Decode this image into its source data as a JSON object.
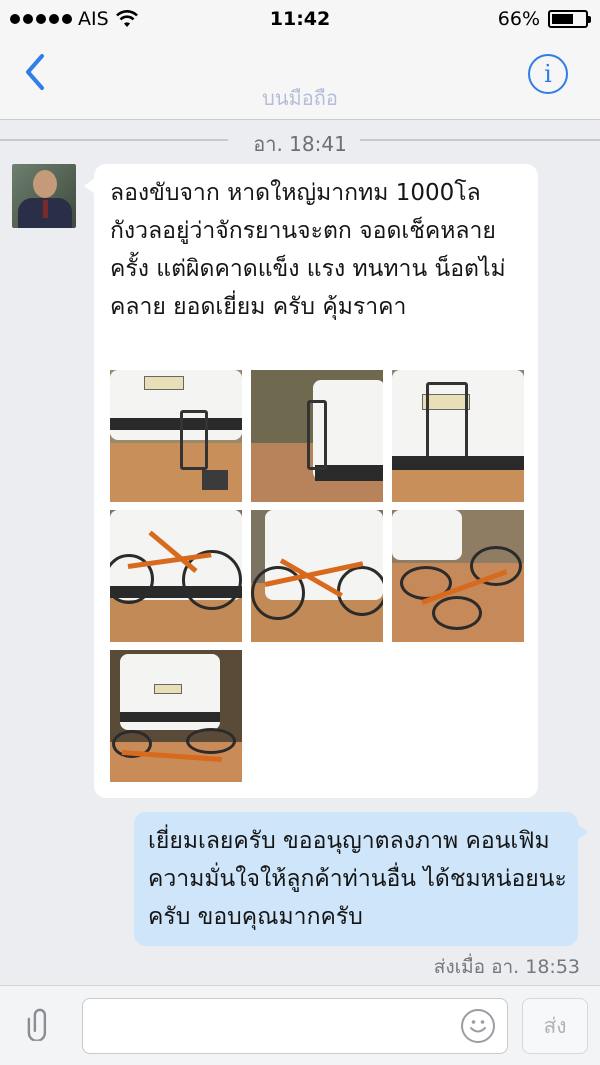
{
  "status_bar": {
    "carrier": "AIS",
    "time": "11:42",
    "battery_percent_label": "66%",
    "battery_level": 0.66
  },
  "nav": {
    "back_icon": "chevron-left-icon",
    "title": "บนมือถือ",
    "info_label": "i"
  },
  "date_divider": "อา. 18:41",
  "incoming": {
    "text": "ลองขับจาก หาดใหญ่มากทม 1000โล กังวลอยู่ว่าจักรยานจะตก จอดเช็คหลายครั้ง แต่ผิดคาดแข็ง แรง ทนทาน น็อตไม่คลาย ยอดเยี่ยม ครับ คุ้มราคา",
    "photos": [
      "photo-1",
      "photo-2",
      "photo-3",
      "photo-4",
      "photo-5",
      "photo-6",
      "photo-7"
    ]
  },
  "outgoing": {
    "text": "เยี่ยมเลยครับ ขออนุญาตลงภาพ คอนเฟิมความมั่นใจให้ลูกค้าท่านอื่น ได้ชมหน่อยนะครับ ขอบคุณมากครับ",
    "status": "ส่งเมื่อ อา. 18:53"
  },
  "input": {
    "placeholder": "",
    "send_label": "ส่ง"
  },
  "colors": {
    "accent": "#2f7ee6",
    "outgoing_bubble": "#cfe6fa",
    "incoming_bubble": "#ffffff",
    "background": "#ebedf0"
  }
}
